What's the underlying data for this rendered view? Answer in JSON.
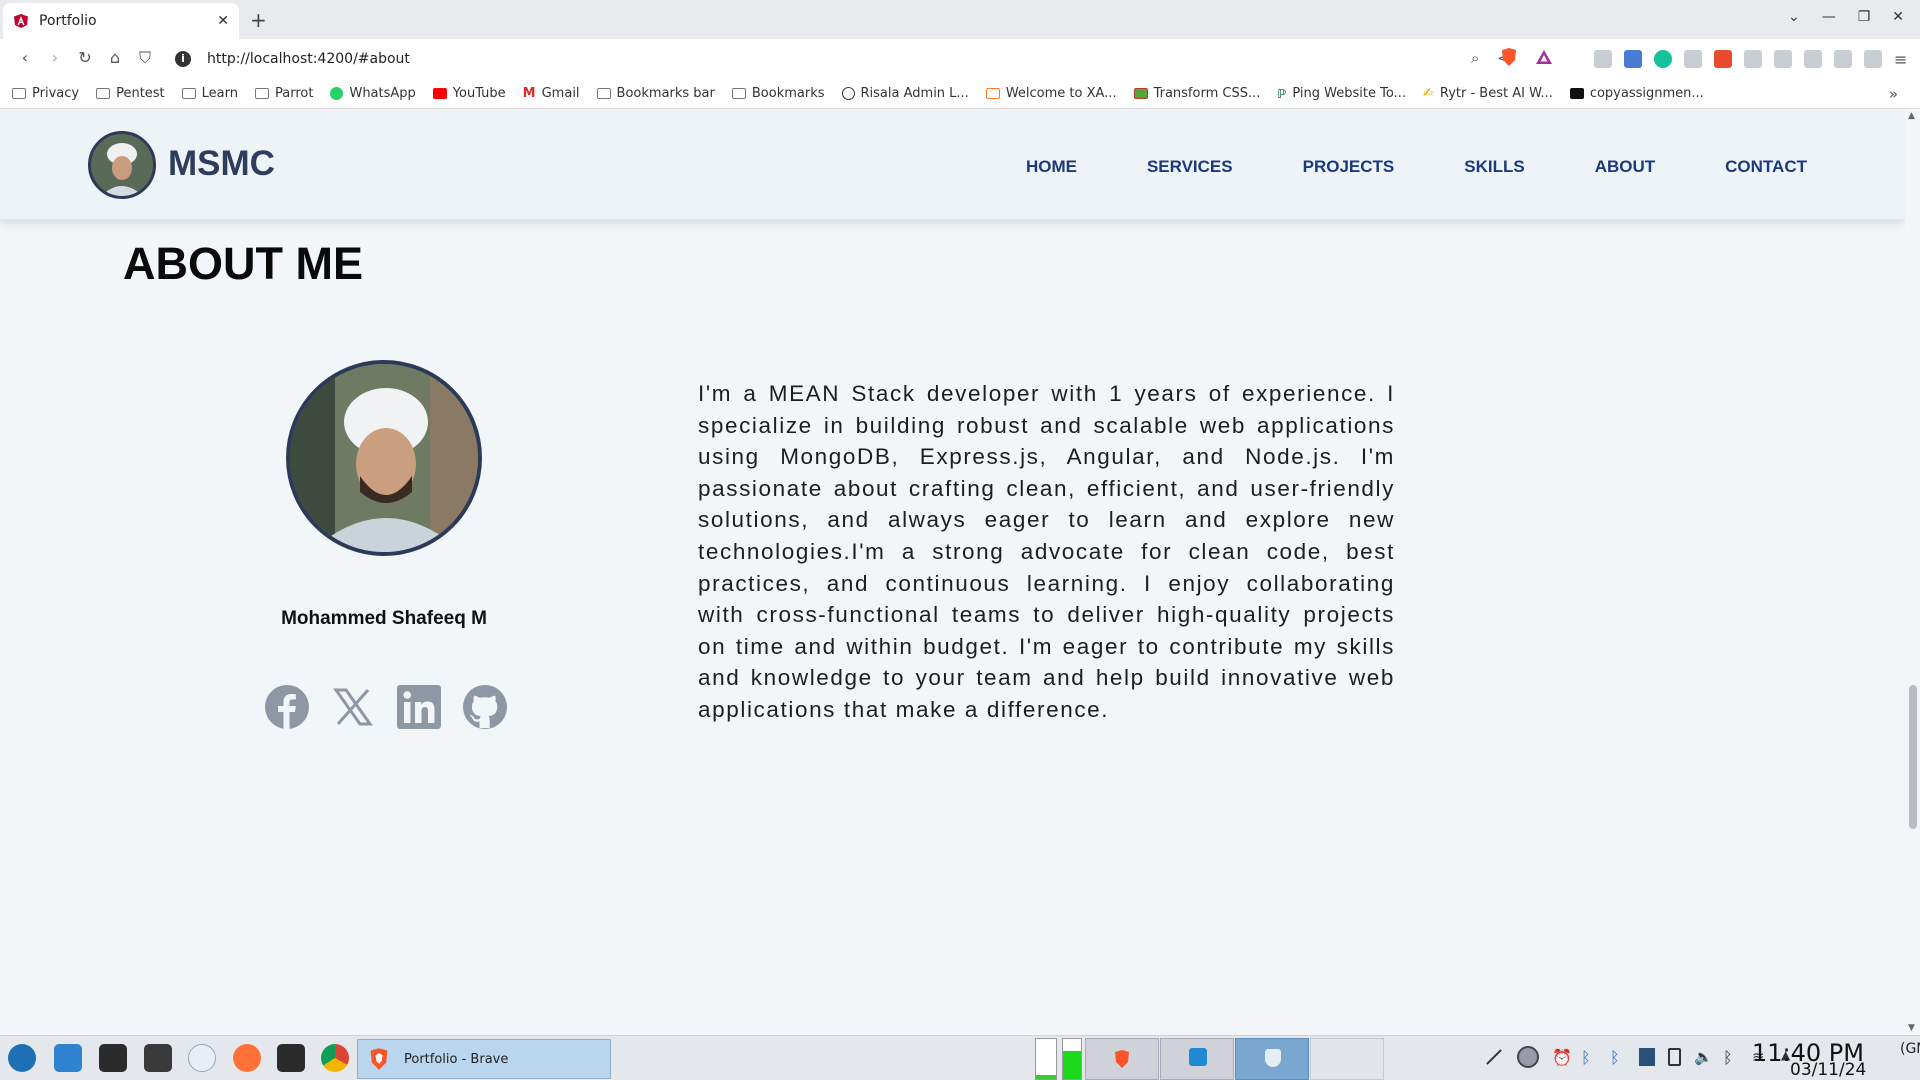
{
  "browser": {
    "tab_title": "Portfolio",
    "url": "http://localhost:4200/#about",
    "bookmarks": [
      "Privacy",
      "Pentest",
      "Learn",
      "Parrot",
      "WhatsApp",
      "YouTube",
      "Gmail",
      "Bookmarks bar",
      "Bookmarks",
      "Risala Admin L...",
      "Welcome to XA...",
      "Transform CSS...",
      "Ping Website To...",
      "Rytr - Best AI W...",
      "copyassignmen..."
    ]
  },
  "header": {
    "brand": "MSMC",
    "nav": [
      "HOME",
      "SERVICES",
      "PROJECTS",
      "SKILLS",
      "ABOUT",
      "CONTACT"
    ]
  },
  "about": {
    "title": "ABOUT ME",
    "name": "Mohammed Shafeeq M",
    "bio": "I'm a MEAN Stack developer with 1 years of experience. I specialize in building robust and scalable web applications using MongoDB, Express.js, Angular, and Node.js. I'm passionate about crafting clean, efficient, and user-friendly solutions, and always eager to learn and explore new technologies.I'm a strong advocate for clean code, best practices, and continuous learning. I enjoy collaborating with cross-functional teams to deliver high-quality projects on time and within budget. I'm eager to contribute my skills and knowledge to your team and help build innovative web applications that make a difference.",
    "socials": [
      "facebook-icon",
      "x-icon",
      "linkedin-icon",
      "github-icon"
    ]
  },
  "taskbar": {
    "active_task": "Portfolio - Brave",
    "time": "11:40 PM",
    "timezone": "(GMT)",
    "date": "03/11/24"
  },
  "colors": {
    "page_bg": "#f3f6f9",
    "nav_link": "#1b3a7c",
    "brand": "#2e3d5c",
    "social_icon": "#8e97a4"
  }
}
